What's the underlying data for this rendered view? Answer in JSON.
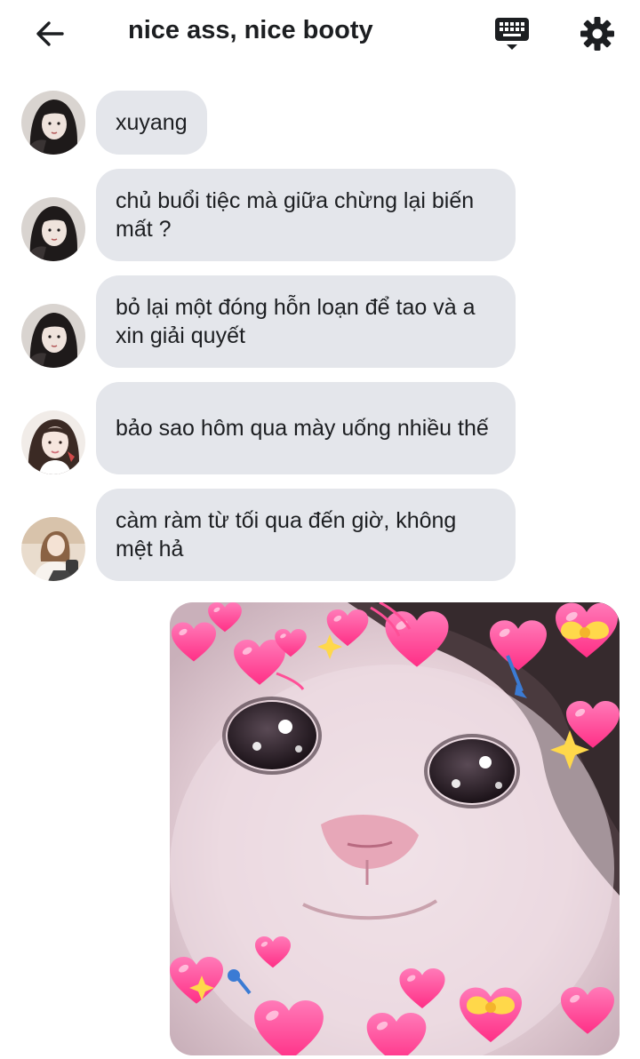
{
  "header": {
    "title": "nice ass, nice booty",
    "back_icon": "arrow-left-icon",
    "keyboard_icon": "keyboard-icon",
    "settings_icon": "gear-icon"
  },
  "messages": [
    {
      "sender": "received",
      "avatar": "avatar-girl-dark",
      "text": "xuyang"
    },
    {
      "sender": "received",
      "avatar": "avatar-girl-dark",
      "text": "chủ buổi tiệc mà giữa chừng lại biến mất ?"
    },
    {
      "sender": "received",
      "avatar": "avatar-girl-dark",
      "text": "bỏ lại một đóng hỗn loạn để tao và a xin giải quyết"
    },
    {
      "sender": "received",
      "avatar": "avatar-girl-light",
      "text": "bảo sao hôm qua mày uống nhiều thế"
    },
    {
      "sender": "received",
      "avatar": "avatar-girl-beige",
      "text": "càm ràm từ tối qua đến giờ, không mệt hả"
    }
  ],
  "image_message": {
    "sender": "sent",
    "description_icon": "crying-cat-hearts-sticker"
  },
  "colors": {
    "bubble_bg": "#e4e6eb",
    "text": "#1c1e21",
    "header_icon": "#1c1e21",
    "heart": "#ff3f8f"
  }
}
